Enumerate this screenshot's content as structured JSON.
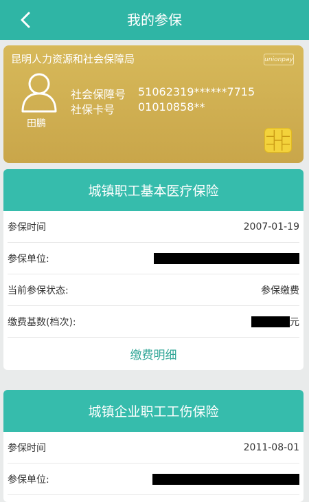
{
  "header": {
    "title": "我的参保"
  },
  "card": {
    "org": "昆明人力资源和社会保障局",
    "brand": "unionpay",
    "holder_name": "田鹏",
    "ss_number_label": "社会保障号",
    "ss_number_value": "51062319******7715",
    "card_number_label": "社保卡号",
    "card_number_value": "01010858**",
    "colors": {
      "gold": "#d7b95a",
      "chip": "#f3d23b"
    }
  },
  "sections": [
    {
      "title": "城镇职工基本医疗保险",
      "rows": [
        {
          "label": "参保时间",
          "value": "2007-01-19"
        },
        {
          "label": "参保单位:",
          "value": ""
        },
        {
          "label": "当前参保状态:",
          "value": "参保缴费"
        },
        {
          "label": "缴费基数(档次):",
          "value": "",
          "suffix": "元"
        }
      ],
      "detail_label": "缴费明细"
    },
    {
      "title": "城镇企业职工工伤保险",
      "rows": [
        {
          "label": "参保时间",
          "value": "2011-08-01"
        },
        {
          "label": "参保单位:",
          "value": ""
        }
      ]
    }
  ],
  "colors": {
    "accent": "#2fb5a5",
    "section_header": "#36bcac",
    "background": "#e9ebeb"
  }
}
